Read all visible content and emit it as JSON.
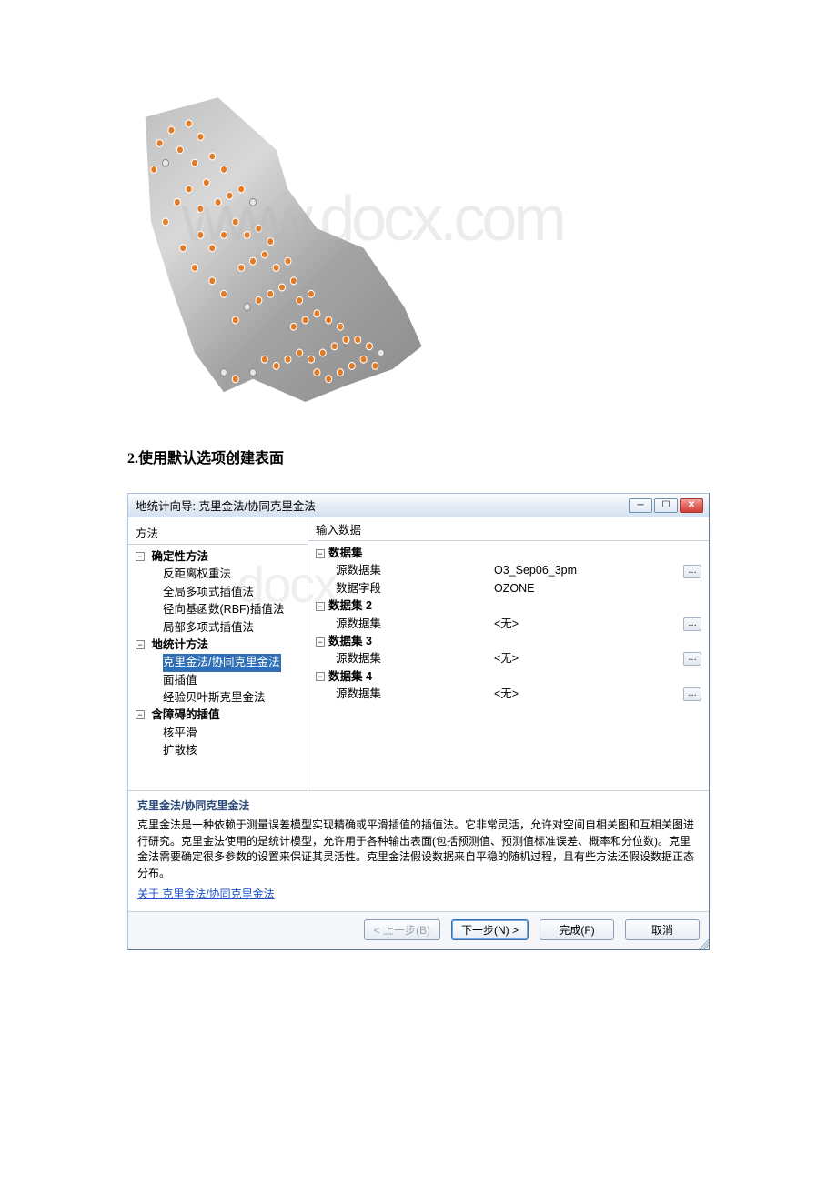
{
  "watermark1": "www.docx.com",
  "watermark2": "docx",
  "section_title": "2.使用默认选项创建表面",
  "dialog": {
    "title": "地统计向导: 克里金法/协同克里金法",
    "methods_header": "方法",
    "input_header": "输入数据",
    "tree": {
      "group1": "确定性方法",
      "g1_items": [
        "反距离权重法",
        "全局多项式插值法",
        "径向基函数(RBF)插值法",
        "局部多项式插值法"
      ],
      "group2": "地统计方法",
      "g2_selected": "克里金法/协同克里金法",
      "g2_items": [
        "面插值",
        "经验贝叶斯克里金法"
      ],
      "group3": "含障碍的插值",
      "g3_items": [
        "核平滑",
        "扩散核"
      ]
    },
    "props": {
      "dataset1_label": "数据集",
      "ds1_source_label": "源数据集",
      "ds1_source_value": "O3_Sep06_3pm",
      "ds1_field_label": "数据字段",
      "ds1_field_value": "OZONE",
      "dataset2_label": "数据集 2",
      "ds2_source_label": "源数据集",
      "none": "<无>",
      "dataset3_label": "数据集 3",
      "ds3_source_label": "源数据集",
      "dataset4_label": "数据集 4",
      "ds4_source_label": "源数据集"
    },
    "desc": {
      "title": "克里金法/协同克里金法",
      "body": "克里金法是一种依赖于测量误差模型实现精确或平滑插值的插值法。它非常灵活，允许对空间自相关图和互相关图进行研究。克里金法使用的是统计模型，允许用于各种输出表面(包括预测值、预测值标准误差、概率和分位数)。克里金法需要确定很多参数的设置来保证其灵活性。克里金法假设数据来自平稳的随机过程，且有些方法还假设数据正态分布。",
      "link": "关于 克里金法/协同克里金法"
    },
    "buttons": {
      "back": "< 上一步(B)",
      "next": "下一步(N) >",
      "finish": "完成(F)",
      "cancel": "取消"
    }
  }
}
